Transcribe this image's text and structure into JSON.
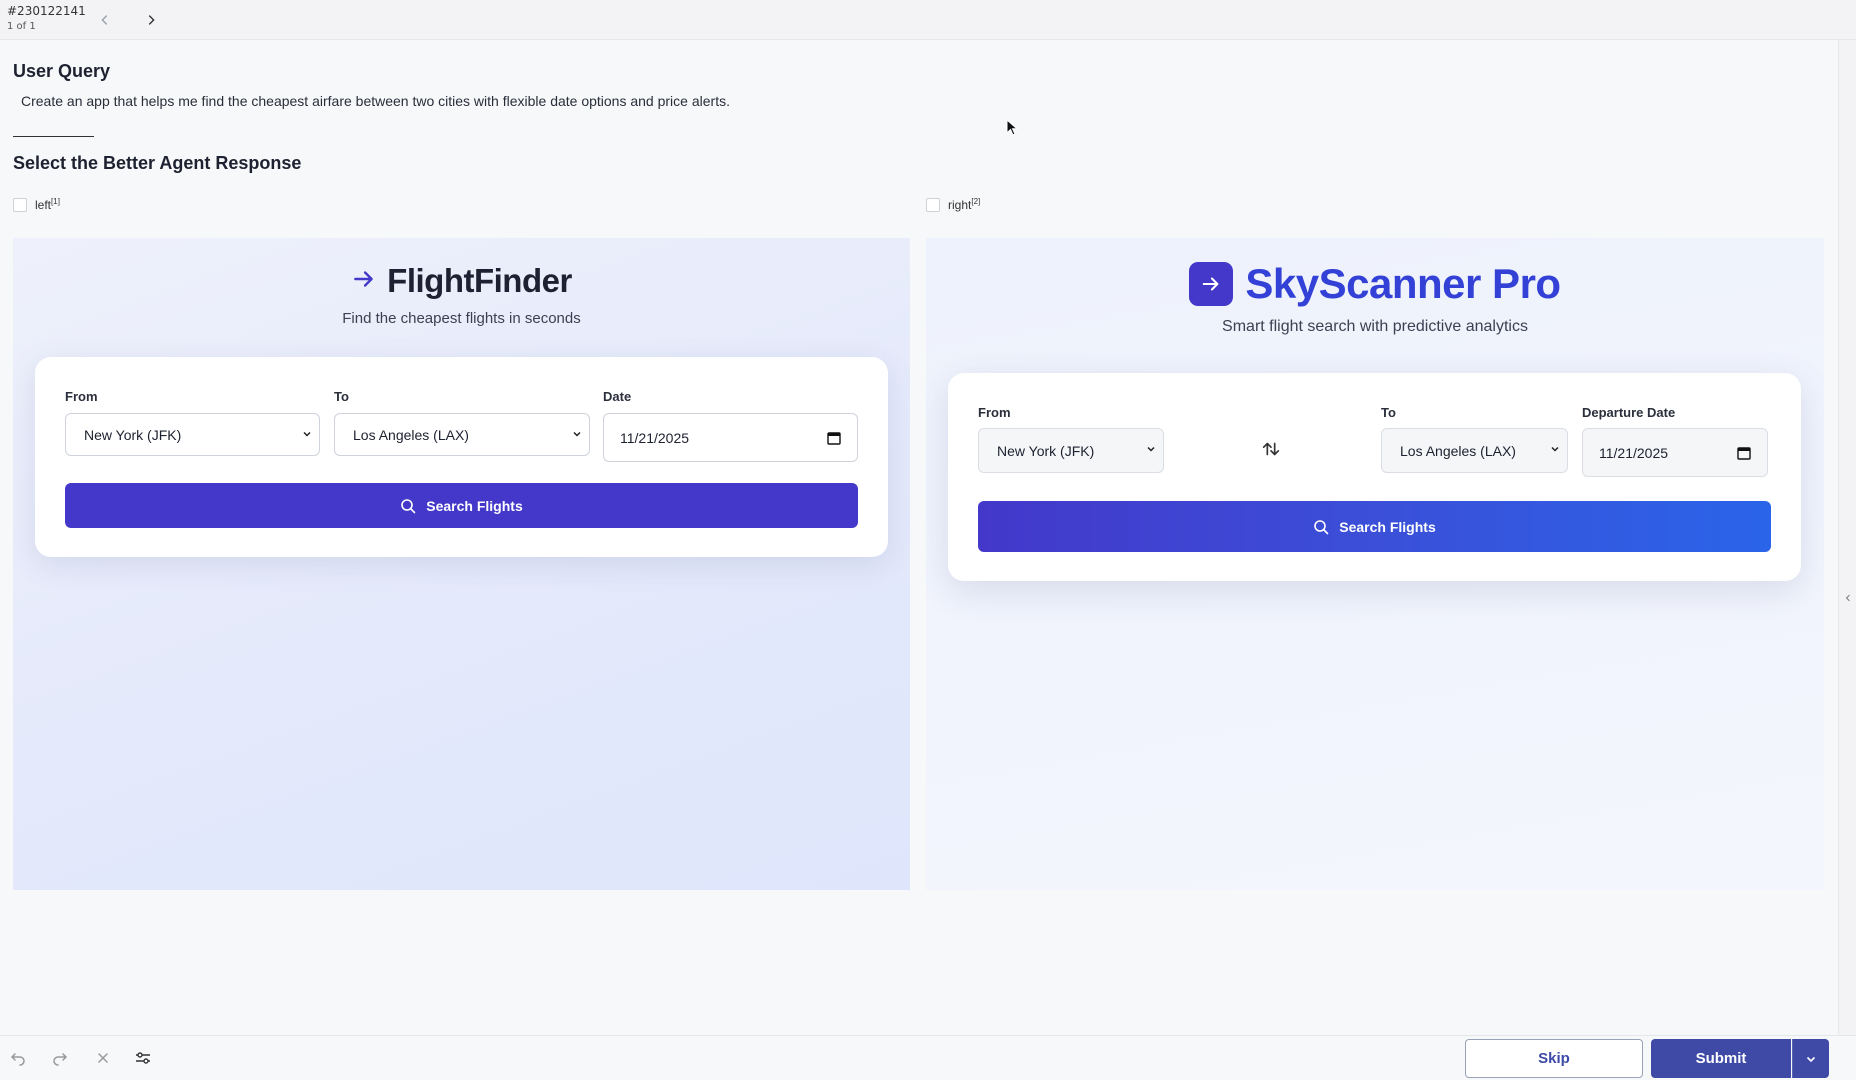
{
  "topbar": {
    "task_id": "#230122141",
    "count": "1 of 1"
  },
  "query": {
    "title": "User Query",
    "text": "Create an app that helps me find the cheapest airfare between two cities with flexible date options and price alerts.",
    "select_title": "Select the Better Agent Response"
  },
  "options": {
    "left_label": "left",
    "left_sup": "[1]",
    "right_label": "right",
    "right_sup": "[2]"
  },
  "left_app": {
    "title": "FlightFinder",
    "subtitle": "Find the cheapest flights in seconds",
    "from_label": "From",
    "from_value": "New York (JFK)",
    "to_label": "To",
    "to_value": "Los Angeles (LAX)",
    "date_label": "Date",
    "date_value": "11/21/2025",
    "search_label": "Search Flights"
  },
  "right_app": {
    "title": "SkyScanner Pro",
    "subtitle": "Smart flight search with predictive analytics",
    "from_label": "From",
    "from_value": "New York (JFK)",
    "to_label": "To",
    "to_value": "Los Angeles (LAX)",
    "date_label": "Departure Date",
    "date_value": "11/21/2025",
    "search_label": "Search Flights"
  },
  "bottom": {
    "skip_label": "Skip",
    "submit_label": "Submit"
  },
  "colors": {
    "primary": "#4338ca",
    "brand_blue": "#3341d6",
    "submit": "#3f4aa6"
  },
  "icons": [
    "chevron-left-icon",
    "chevron-right-icon",
    "arrow-right-icon",
    "search-icon",
    "swap-icon",
    "calendar-icon",
    "undo-icon",
    "redo-icon",
    "close-icon",
    "sliders-icon",
    "chevron-down-icon"
  ]
}
